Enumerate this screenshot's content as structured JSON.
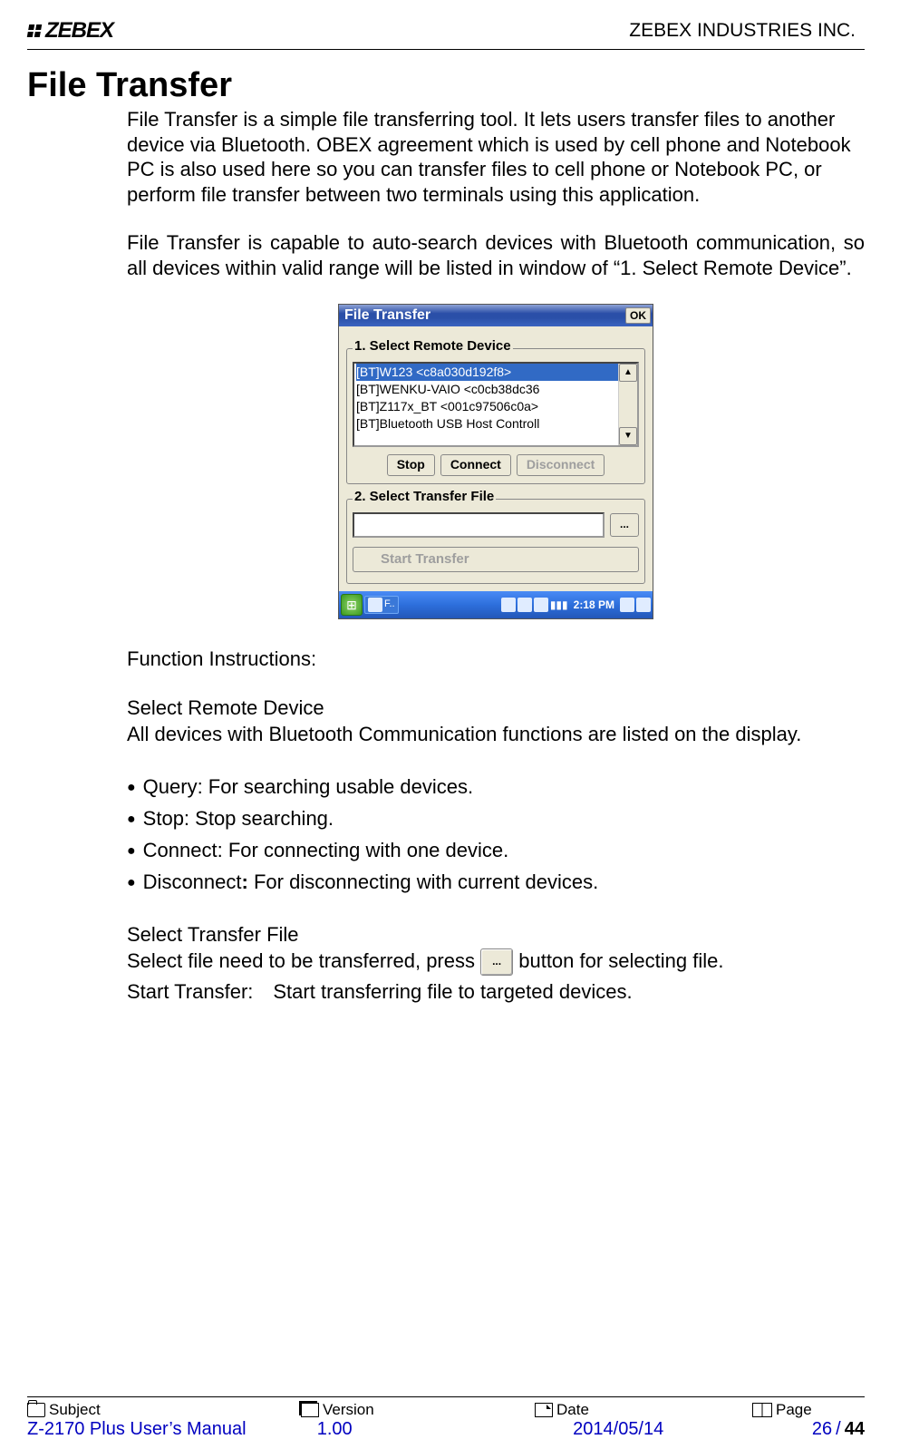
{
  "header": {
    "logo_text": "ZEBEX",
    "company": "ZEBEX INDUSTRIES INC."
  },
  "title": "File Transfer",
  "paragraphs": {
    "p1": "File Transfer is a simple file transferring tool. It lets users transfer files to another device via Bluetooth. OBEX agreement which is used by cell phone and Notebook PC is also used here so you can transfer files to cell phone or Notebook PC, or perform file transfer between two terminals using this application.",
    "p2": "File Transfer is capable to auto-search devices with Bluetooth communication, so all devices within valid range will be listed in window of “1. Select Remote Device”."
  },
  "screenshot": {
    "window_title": "File Transfer",
    "ok": "OK",
    "group1_label": "1. Select Remote Device",
    "devices": [
      "[BT]W123 <c8a030d192f8>",
      "[BT]WENKU-VAIO <c0cb38dc36",
      "[BT]Z117x_BT <001c97506c0a>",
      "[BT]Bluetooth USB Host Controll"
    ],
    "stop": "Stop",
    "connect": "Connect",
    "disconnect": "Disconnect",
    "group2_label": "2. Select Transfer File",
    "browse": "...",
    "start_transfer": "Start Transfer",
    "taskbar_app": "F..",
    "time": "2:18 PM"
  },
  "instructions": {
    "heading": "Function Instructions:",
    "select_remote_heading": "Select Remote Device",
    "select_remote_text": "All devices with Bluetooth Communication functions are listed on the display.",
    "bullets": {
      "b1": "Query: For searching usable devices.",
      "b2": "Stop: Stop searching.",
      "b3": "Connect: For connecting with one device.",
      "b4_prefix": "Disconnect",
      "b4_rest": " For disconnecting with current devices."
    },
    "select_file_heading": "Select Transfer File",
    "select_file_text_before": "Select file need to be transferred, press ",
    "inline_btn": "...",
    "select_file_text_after": " button for selecting file.",
    "start_transfer_line": "Start Transfer: Start transferring file to targeted devices."
  },
  "footer": {
    "labels": {
      "subject": "Subject",
      "version": "Version",
      "date": "Date",
      "page": "Page"
    },
    "values": {
      "subject": "Z-2170 Plus User’s Manual",
      "version": "1.00",
      "date": "2014/05/14",
      "page_current": "26",
      "page_sep": " / ",
      "page_total": "44"
    }
  }
}
